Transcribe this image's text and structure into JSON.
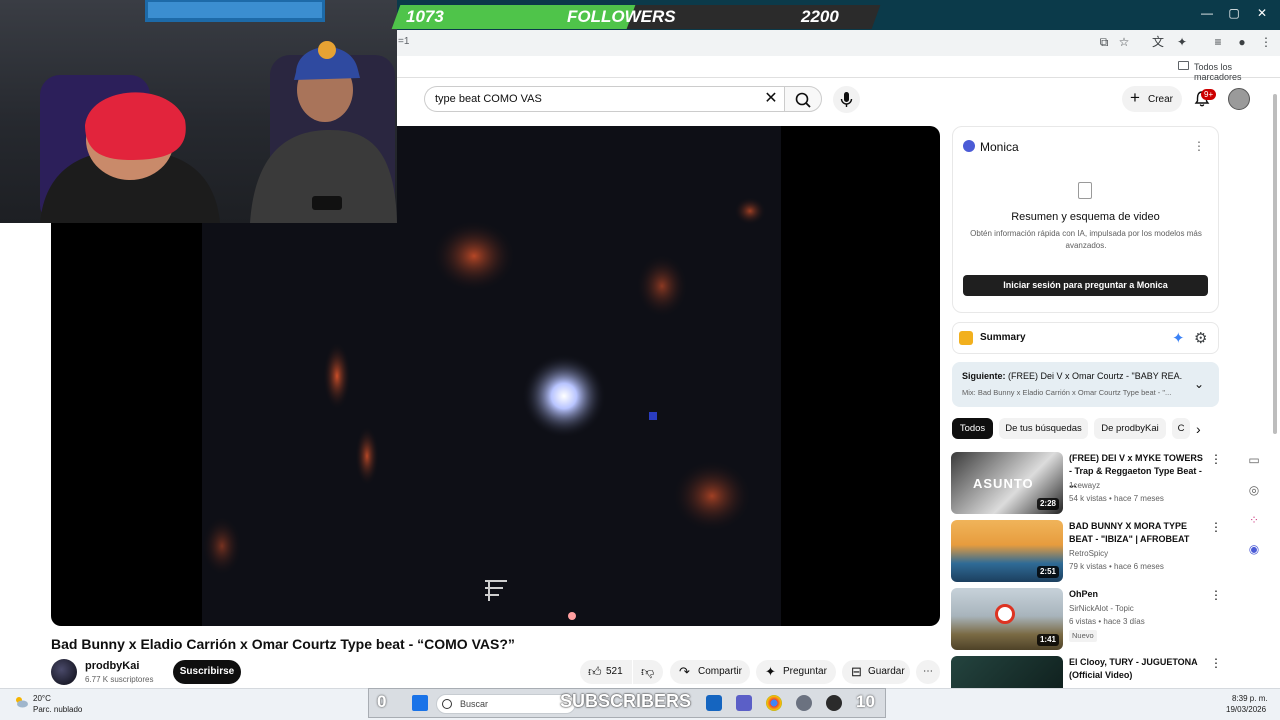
{
  "stream_overlay": {
    "followers_label": "FOLLOWERS",
    "followers_current": "1073",
    "followers_goal": "2200",
    "followers_progress": 0.49,
    "subscribers_label": "SUBSCRIBERS",
    "subscribers_current": "0",
    "subscribers_goal": "10",
    "subscribers_progress": 0.0
  },
  "browser": {
    "url_fragment": "=1",
    "bookmarks_label": "Todos los marcadores"
  },
  "header": {
    "search_value": "type beat COMO VAS",
    "create_label": "Crear",
    "notifications_badge": "9+"
  },
  "video": {
    "title": "Bad Bunny x Eladio Carrión x Omar Courtz Type beat - “COMO VAS?”",
    "channel_name": "prodbyKai",
    "channel_subscribers": "6.77 K suscriptores",
    "subscribe_label": "Suscribirse",
    "likes": "521",
    "share_label": "Compartir",
    "ask_label": "Preguntar",
    "save_label": "Guardar"
  },
  "monica": {
    "title": "Monica",
    "heading": "Resumen y esquema de video",
    "description": "Obtén información rápida con IA, impulsada por los modelos más avanzados.",
    "login_label": "Iniciar sesión para preguntar a Monica"
  },
  "summary": {
    "title": "Summary"
  },
  "up_next": {
    "prefix": "Siguiente:",
    "title": "(FREE) Dei V x Omar Courtz - \"BABY REA...",
    "subtitle": "Mix: Bad Bunny x Eladio Carrión x Omar Courtz Type beat - \"..."
  },
  "chips": [
    "Todos",
    "De tus búsquedas",
    "De prodbyKai",
    "C"
  ],
  "recommendations": [
    {
      "title": "(FREE) DEI V x MYKE TOWERS - Trap & Reggaeton Type Beat - ...",
      "channel": "1cewayz",
      "meta": "54 k vistas • hace 7 meses",
      "duration": "2:28",
      "thumb_text": "ASUNTO",
      "thumb_colors": [
        "#5a5a5a",
        "#d8d8d8"
      ]
    },
    {
      "title": "BAD BUNNY X MORA TYPE BEAT - \"IBIZA\"  | AFROBEAT",
      "channel": "RetroSpicy",
      "meta": "79 k vistas • hace 6 meses",
      "duration": "2:51",
      "thumb_text": "",
      "thumb_colors": [
        "#e7a44a",
        "#2d5f8a"
      ]
    },
    {
      "title": "OhPen",
      "channel": "SirNickAlot - Topic",
      "meta": "6 vistas • hace 3 días",
      "badge": "Nuevo",
      "duration": "1:41",
      "thumb_text": "",
      "thumb_colors": [
        "#b8c4cc",
        "#6b5a3a"
      ]
    },
    {
      "title": "El Clooy, TURY - JUGUETONA (Official Video)",
      "channel": "",
      "meta": "",
      "duration": "",
      "thumb_text": "",
      "thumb_colors": [
        "#1e3a36",
        "#0c1a18"
      ]
    }
  ],
  "taskbar": {
    "weather_temp": "20°C",
    "weather_desc": "Parc. nublado",
    "search_placeholder": "Buscar",
    "time": "8:39 p. m.",
    "date": "19/03/2026"
  },
  "colors": {
    "followers_fill": "#4fc44a",
    "brand_red": "#cc0000",
    "subscribe_bg": "#0f0f0f"
  }
}
